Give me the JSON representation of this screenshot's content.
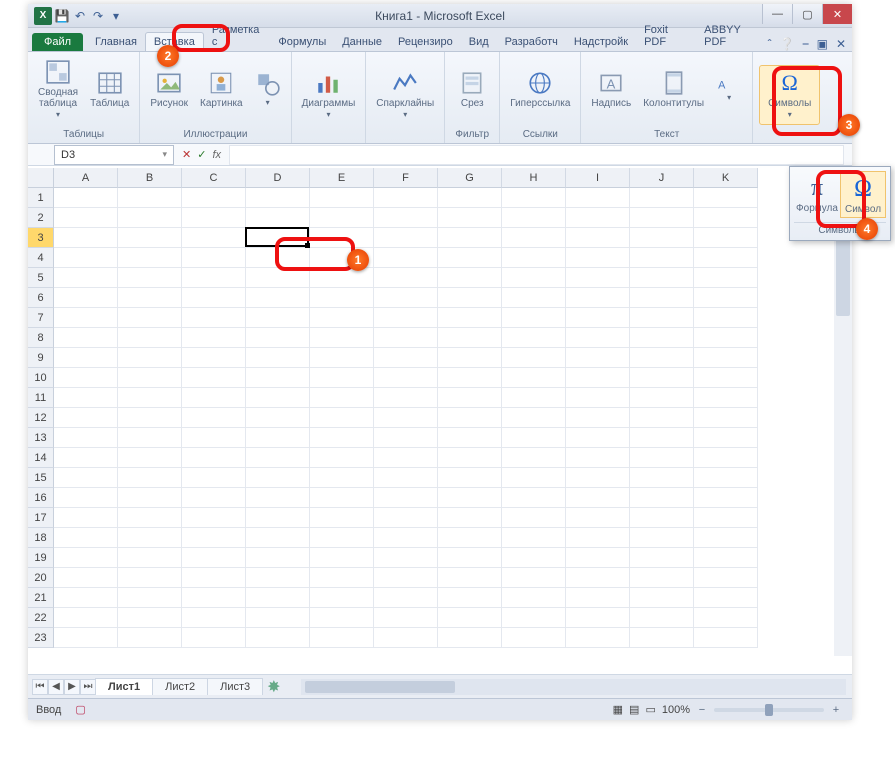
{
  "title": "Книга1 - Microsoft Excel",
  "qat": {
    "excel": "X"
  },
  "tabs": {
    "file": "Файл",
    "items": [
      "Главная",
      "Вставка",
      "Разметка с",
      "Формулы",
      "Данные",
      "Рецензиро",
      "Вид",
      "Разработч",
      "Надстройк",
      "Foxit PDF",
      "ABBYY PDF"
    ],
    "active_index": 1
  },
  "ribbon": {
    "groups": [
      {
        "label": "Таблицы",
        "buttons": [
          {
            "name": "pivot",
            "label": "Сводная\nтаблица"
          },
          {
            "name": "table",
            "label": "Таблица"
          }
        ]
      },
      {
        "label": "Иллюстрации",
        "buttons": [
          {
            "name": "picture",
            "label": "Рисунок"
          },
          {
            "name": "clipart",
            "label": "Картинка"
          },
          {
            "name": "shapes",
            "label": ""
          }
        ]
      },
      {
        "label": "",
        "buttons": [
          {
            "name": "charts",
            "label": "Диаграммы"
          }
        ]
      },
      {
        "label": "",
        "buttons": [
          {
            "name": "spark",
            "label": "Спарклайны"
          }
        ]
      },
      {
        "label": "Фильтр",
        "buttons": [
          {
            "name": "slicer",
            "label": "Срез"
          }
        ]
      },
      {
        "label": "Ссылки",
        "buttons": [
          {
            "name": "hyper",
            "label": "Гиперссылка"
          }
        ]
      },
      {
        "label": "Текст",
        "buttons": [
          {
            "name": "textbox",
            "label": "Надпись"
          },
          {
            "name": "headerfooter",
            "label": "Колонтитулы"
          },
          {
            "name": "textmore",
            "label": ""
          }
        ]
      },
      {
        "label": "",
        "buttons": [
          {
            "name": "symbols",
            "label": "Символы"
          }
        ]
      }
    ]
  },
  "namebox": {
    "value": "D3"
  },
  "fx": {
    "label": "fx"
  },
  "columns": [
    "A",
    "B",
    "C",
    "D",
    "E",
    "F",
    "G",
    "H",
    "I",
    "J",
    "K"
  ],
  "rows": [
    "1",
    "2",
    "3",
    "4",
    "5",
    "6",
    "7",
    "8",
    "9",
    "10",
    "11",
    "12",
    "13",
    "14",
    "15",
    "16",
    "17",
    "18",
    "19",
    "20",
    "21",
    "22",
    "23"
  ],
  "selected": {
    "col": 3,
    "row": 2
  },
  "sheettabs": {
    "items": [
      "Лист1",
      "Лист2",
      "Лист3"
    ],
    "active_index": 0
  },
  "status": {
    "left": "Ввод",
    "zoom": "100%"
  },
  "dropdown": {
    "formula": "Формула",
    "symbol": "Символ",
    "group": "Символы",
    "pi": "π",
    "omega": "Ω"
  },
  "callouts": {
    "n1": "1",
    "n2": "2",
    "n3": "3",
    "n4": "4"
  }
}
